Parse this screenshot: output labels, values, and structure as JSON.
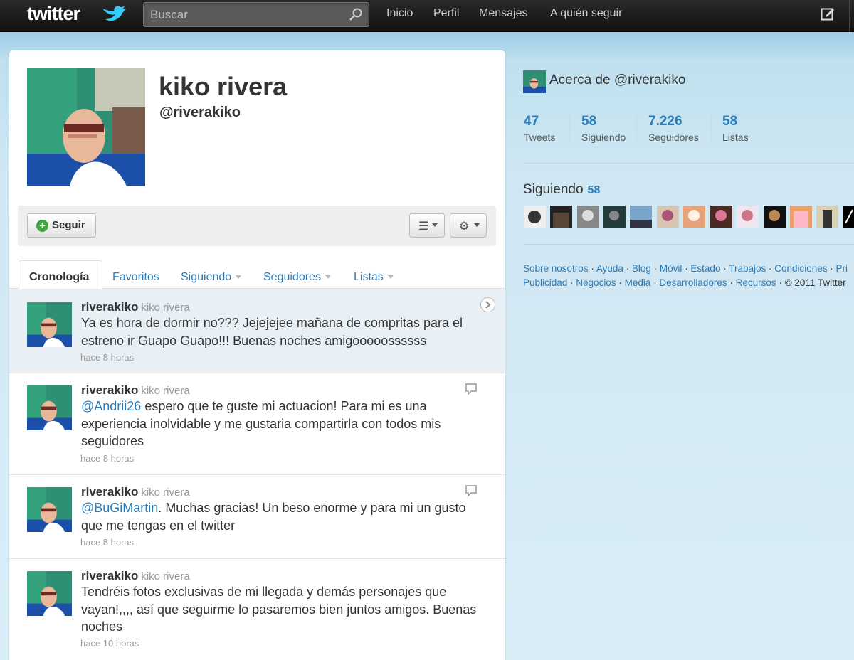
{
  "topbar": {
    "logo": "twitter",
    "search_placeholder": "Buscar",
    "nav": [
      "Inicio",
      "Perfil",
      "Mensajes",
      "A quién seguir"
    ],
    "icons": {
      "search": "search-icon",
      "compose": "compose-icon",
      "bird": "bird-icon"
    }
  },
  "profile": {
    "name": "kiko rivera",
    "handle": "@riverakiko",
    "follow_label": "Seguir"
  },
  "tabs": {
    "items": [
      "Cronología",
      "Favoritos",
      "Siguiendo",
      "Seguidores",
      "Listas"
    ],
    "active": "Cronología"
  },
  "tweets": [
    {
      "user": "riverakiko",
      "name": "kiko rivera",
      "text": "Ya es hora de dormir no??? Jejejejee mañana de compritas para el estreno ir Guapo Guapo!!! Buenas noches amigooooossssss",
      "time": "hace 8 horas"
    },
    {
      "user": "riverakiko",
      "name": "kiko rivera",
      "mention": "@Andrii26",
      "text": " espero que te guste mi actuacion! Para mi es una experiencia inolvidable y me gustaria compartirla con todos mis seguidores",
      "time": "hace 8 horas"
    },
    {
      "user": "riverakiko",
      "name": "kiko rivera",
      "mention": "@BuGiMartin",
      "text": ". Muchas gracias! Un beso enorme y para mi un gusto que me tengas en el twitter",
      "time": "hace 8 horas"
    },
    {
      "user": "riverakiko",
      "name": "kiko rivera",
      "text": "Tendréis fotos exclusivas de mi llegada y demás personajes que vayan!,,,, así que seguirme lo pasaremos bien juntos amigos. Buenas noches",
      "time": "hace 10 horas"
    }
  ],
  "sidebar": {
    "about": "Acerca de @riverakiko",
    "stats": [
      {
        "num": "47",
        "label": "Tweets"
      },
      {
        "num": "58",
        "label": "Siguiendo"
      },
      {
        "num": "7.226",
        "label": "Seguidores"
      },
      {
        "num": "58",
        "label": "Listas"
      }
    ],
    "following_title": "Siguiendo",
    "following_count": "58",
    "footer_line1": [
      "Sobre nosotros",
      "Ayuda",
      "Blog",
      "Móvil",
      "Estado",
      "Trabajos",
      "Condiciones",
      "Pri"
    ],
    "footer_line2": [
      "Publicidad",
      "Negocios",
      "Media",
      "Desarrolladores",
      "Recursos"
    ],
    "copyright": "© 2011 Twitter"
  },
  "colors": {
    "link": "#2b7bb9",
    "topbar": "#1a1a1a",
    "background": "#c0deed",
    "follow_green": "#3ea93b"
  }
}
